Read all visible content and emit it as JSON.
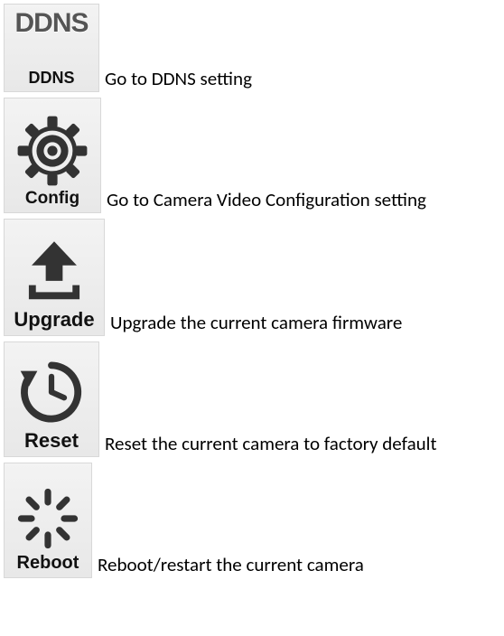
{
  "items": [
    {
      "icon_name": "ddns-icon",
      "icon_top_text": "DDNS",
      "icon_label": "DDNS",
      "description": "Go to DDNS setting"
    },
    {
      "icon_name": "config-icon",
      "icon_label": "Config",
      "description": "Go to Camera Video Configuration setting"
    },
    {
      "icon_name": "upgrade-icon",
      "icon_label": "Upgrade",
      "description": "Upgrade the current camera firmware"
    },
    {
      "icon_name": "reset-icon",
      "icon_label": "Reset",
      "description": "Reset the current camera to factory default"
    },
    {
      "icon_name": "reboot-icon",
      "icon_label": "Reboot",
      "description": "Reboot/restart the current camera"
    }
  ]
}
